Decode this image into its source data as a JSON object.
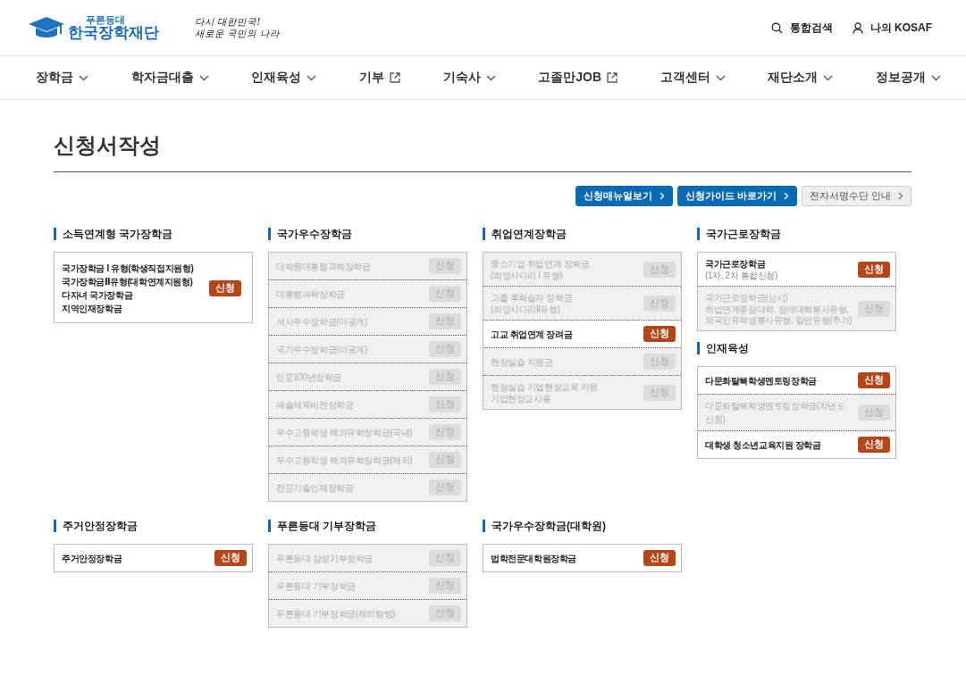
{
  "header": {
    "logo": {
      "small": "푸른등대",
      "name": "한국장학재단"
    },
    "slogan": [
      "다시 대한민국!",
      "새로운 국민의 나라"
    ],
    "utility": [
      {
        "kind": "search",
        "label": "통합검색"
      },
      {
        "kind": "user",
        "label": "나의 KOSAF"
      }
    ]
  },
  "nav": [
    {
      "label": "장학금",
      "kind": "dropdown"
    },
    {
      "label": "학자금대출",
      "kind": "dropdown"
    },
    {
      "label": "인재육성",
      "kind": "dropdown"
    },
    {
      "label": "기부",
      "kind": "external"
    },
    {
      "label": "기숙사",
      "kind": "dropdown"
    },
    {
      "label": "고졸만JOB",
      "kind": "external"
    },
    {
      "label": "고객센터",
      "kind": "dropdown"
    },
    {
      "label": "재단소개",
      "kind": "dropdown"
    },
    {
      "label": "정보공개",
      "kind": "dropdown"
    }
  ],
  "page_title": "신청서작성",
  "links": [
    {
      "label": "신청매뉴얼보기",
      "kind": "primary"
    },
    {
      "label": "신청가이드 바로가기",
      "kind": "primary"
    },
    {
      "label": "전자서명수단 안내",
      "kind": "secondary"
    }
  ],
  "rows": [
    [
      [
        {
          "title": "소득연계형 국가장학금",
          "items": [
            {
              "lines": [
                "국가장학금 I 유형(학생직접지원형)",
                "국가장학금Ⅱ유형(대학연계지원형)",
                "다자녀 국가장학금",
                "지역인재장학금"
              ],
              "button": "신청",
              "disabled": false
            }
          ]
        }
      ],
      [
        {
          "title": "국가우수장학금",
          "items": [
            {
              "lines": [
                "대학원대통령과학장학금"
              ],
              "button": "신청",
              "disabled": true
            },
            {
              "lines": [
                "대통령과학장학금"
              ],
              "button": "신청",
              "disabled": true
            },
            {
              "lines": [
                "석사우수장학금(이공계)"
              ],
              "button": "신청",
              "disabled": true
            },
            {
              "lines": [
                "국가우수장학금(이공계)"
              ],
              "button": "신청",
              "disabled": true
            },
            {
              "lines": [
                "인문100년장학금"
              ],
              "button": "신청",
              "disabled": true
            },
            {
              "lines": [
                "예술체육비전장학금"
              ],
              "button": "신청",
              "disabled": true
            },
            {
              "lines": [
                "우수고등학생 해외유학장학금(국내)"
              ],
              "button": "신청",
              "disabled": true
            },
            {
              "lines": [
                "우수고등학생 해외유학장학금(해외)"
              ],
              "button": "신청",
              "disabled": true
            },
            {
              "lines": [
                "전문기술인재장학금"
              ],
              "button": "신청",
              "disabled": true
            }
          ]
        }
      ],
      [
        {
          "title": "취업연계장학금",
          "items": [
            {
              "lines": [
                "중소기업 취업연계 장학금"
              ],
              "note": "(희망사다리 I 유형)",
              "button": "신청",
              "disabled": true
            },
            {
              "lines": [
                "고졸 후학습자 장학금"
              ],
              "note": "(희망사다리Ⅱ유형)",
              "button": "신청",
              "disabled": true
            },
            {
              "lines": [
                "고교 취업연계 장려금"
              ],
              "button": "신청",
              "disabled": false
            },
            {
              "lines": [
                "현장실습 지원금"
              ],
              "button": "신청",
              "disabled": true
            },
            {
              "lines": [
                "현장실습 기업현장교육 지원"
              ],
              "note": "기업현장교사용",
              "button": "신청",
              "disabled": true
            }
          ]
        }
      ],
      [
        {
          "title": "국가근로장학금",
          "items": [
            {
              "lines": [
                "국가근로장학금"
              ],
              "note": "(1차, 2차 통합신청)",
              "button": "신청",
              "disabled": false
            },
            {
              "lines": [
                "국가근로장학금(상시)"
              ],
              "note": "취업연계중점대학, 장애대학봉사유형, 외국인유학생봉사유형, 일반유형(추가)",
              "button": "신청",
              "disabled": true
            }
          ]
        },
        {
          "title": "인재육성",
          "items": [
            {
              "lines": [
                "다문화탈북학생멘토링장학금"
              ],
              "button": "신청",
              "disabled": false
            },
            {
              "lines": [
                "다문화탈북학생멘토링장학금(차년도 신청)"
              ],
              "button": "신청",
              "disabled": true
            },
            {
              "lines": [
                "대학생 청소년교육지원 장학금"
              ],
              "button": "신청",
              "disabled": false
            }
          ]
        }
      ]
    ],
    [
      [
        {
          "title": "주거안정장학금",
          "items": [
            {
              "lines": [
                "주거안정장학금"
              ],
              "button": "신청",
              "disabled": false
            }
          ]
        }
      ],
      [
        {
          "title": "푸른등대 기부장학금",
          "items": [
            {
              "lines": [
                "푸른등대 삼성기부장학금"
              ],
              "button": "신청",
              "disabled": true
            },
            {
              "lines": [
                "푸른등대 기부장학금"
              ],
              "button": "신청",
              "disabled": true
            },
            {
              "lines": [
                "푸른등대 기부장학금(해외탐방)"
              ],
              "button": "신청",
              "disabled": true
            }
          ]
        }
      ],
      [
        {
          "title": "국가우수장학금(대학원)",
          "items": [
            {
              "lines": [
                "법학전문대학원장학금"
              ],
              "button": "신청",
              "disabled": false
            }
          ]
        }
      ],
      []
    ]
  ]
}
